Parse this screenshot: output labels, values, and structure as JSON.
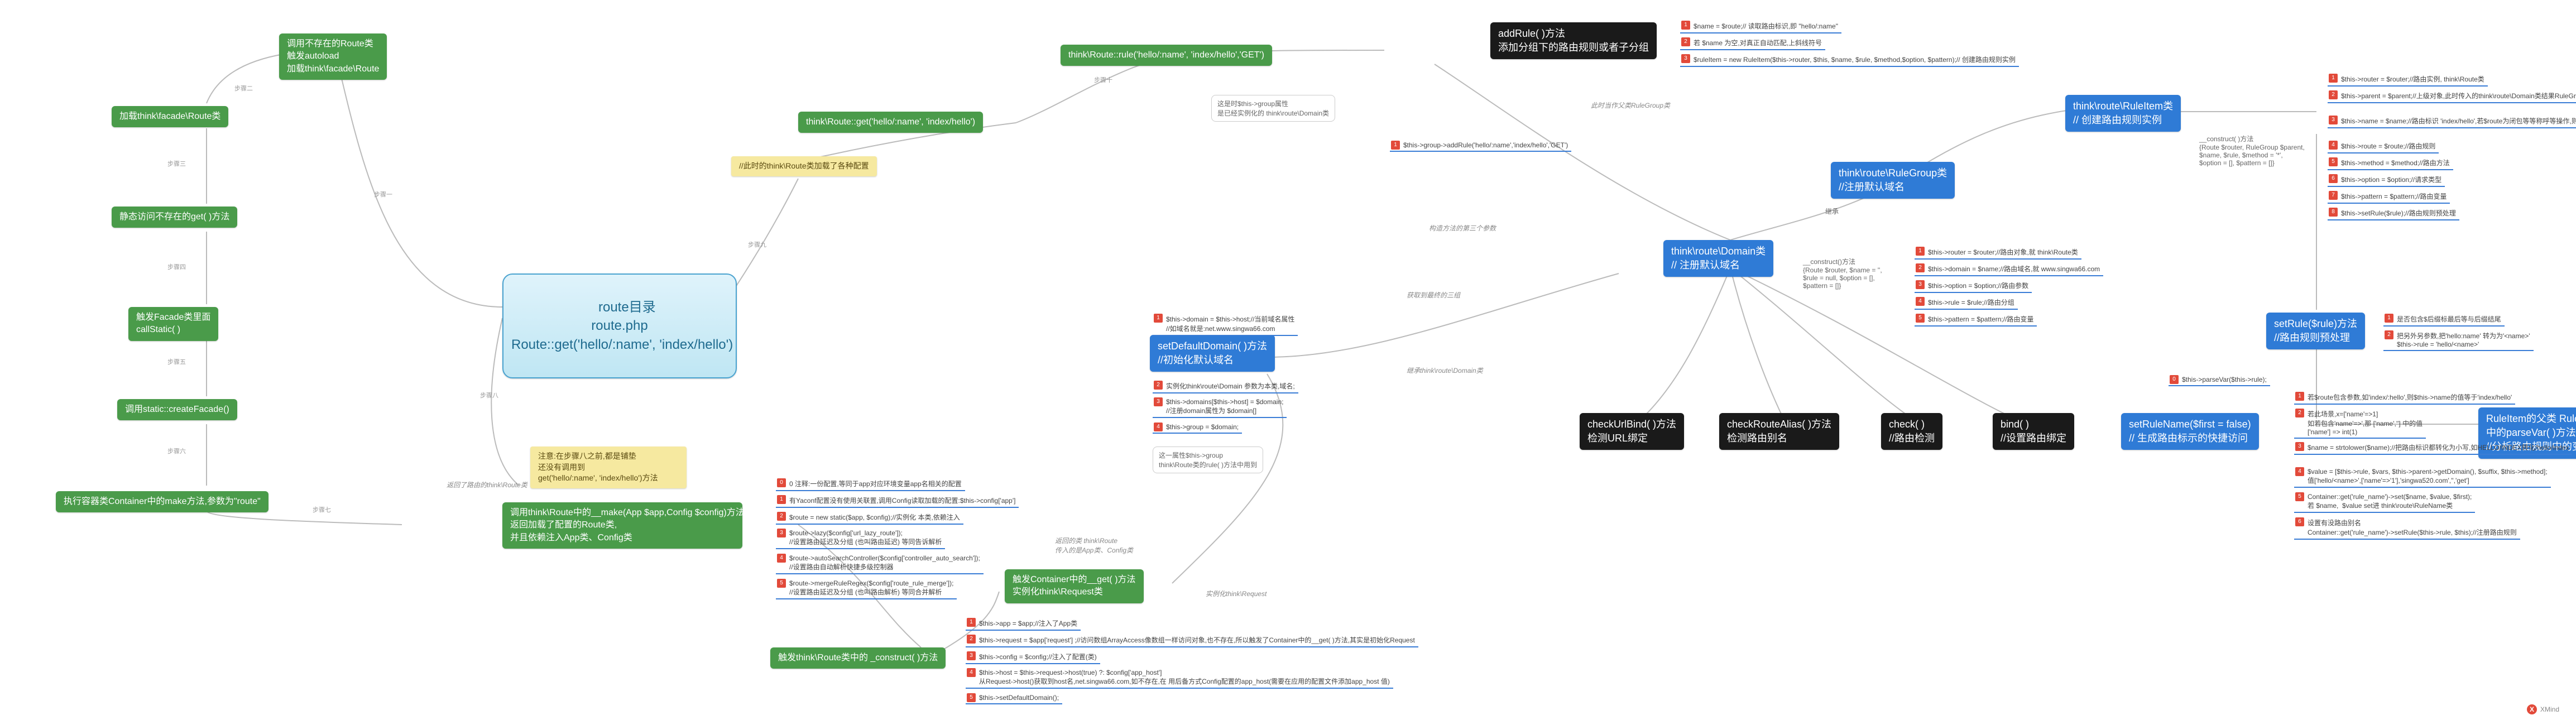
{
  "central": "route目录\nroute.php\nRoute::get('hello/:name', 'index/hello')",
  "left": {
    "n1": "调用不存在的Route类\n触发autoload\n加载think\\facade\\Route",
    "n2": "加载think\\facade\\Route类",
    "n3": "静态访问不存在的get( )方法",
    "n4": "触发Facade类里面\ncallStatic( )",
    "n5": "调用static::createFacade()",
    "n6": "执行容器类Container中的make方法,参数为\"route\"",
    "y1": "注意:在步骤八之前,都是铺垫\n还没有调用到\nget('hello/:name', 'index/hello')方法",
    "g1": "调用think\\Route中的__make(App $app,Config $config)方法,\n返回加载了配置的Route类,\n并且依赖注入App类、Config类"
  },
  "top": {
    "y2": "//此时的think\\Route类加载了各种配置",
    "g2": "think\\Route::get('hello/:name', 'index/hello')",
    "g3": "think\\Route::rule('hello/:name', 'index/hello','GET')",
    "callout1": "这是时$this->group属性\n是已经实例化的 think\\route\\Domain类",
    "t1": "$this->group->addRule('hello/:name','index/hello','GET')"
  },
  "black": {
    "addRule": "addRule( )方法\n添加分组下的路由规则或者子分组",
    "checkUrlBind": "checkUrlBind( )方法\n检测URL绑定",
    "checkRouteAlias": "checkRouteAlias( )方法\n检测路由别名",
    "check": "check( )\n//路由检测",
    "bind": "bind( )\n//设置路由绑定"
  },
  "blue": {
    "setDefaultDomain": "setDefaultDomain( )方法\n//初始化默认域名",
    "ruleGroup": "think\\route\\RuleGroup类\n//注册默认域名",
    "domain": "think\\route\\Domain类\n// 注册默认域名",
    "ruleItem": "think\\route\\RuleItem类\n// 创建路由规则实例",
    "setRule": "setRule($rule)方法\n//路由规则预处理",
    "setRuleName": "setRuleName($first = false)\n// 生成路由标示的快捷访问",
    "parseVar": "RuleItem的父类 Rule类\n中的parseVar( )方法\n//分析路由规则中的变量"
  },
  "green_bottom": {
    "containerGet": "触发Container中的__get( )方法\n实例化think\\Request类",
    "construct": "触发think\\Route类中的 _construct( )方法"
  },
  "notes_make": [
    "0 注释:一份配置,等同于app对应环境变量app名相关的配置",
    "有Yaconf配置没有使用关联置,调用Config读取加载的配置:$this->config['app']",
    "$route = new static($app, $config);//实例化 本类,依赖注入",
    "$route->lazy($config['url_lazy_route']);\n//设置路由延迟及分组 (也叫路由延迟) 等同告诉解析",
    "$route->autoSearchController($config['controller_auto_search']);\n//设置路由自动解析快捷多级控制器",
    "$route->mergeRuleRegex($config['route_rule_merge']);\n//设置路由延迟及分组 (也叫路由解析) 等同合并解析"
  ],
  "notes_construct": [
    "$this->app = $app;//注入了App类",
    "$this->request = $app['request'] ;//访问数组ArrayAccess像数组一样访问对象,也不存在,所以触发了Container中的__get( )方法,其实是初始化Request",
    "$this->config = $config;//注入了配置(类)",
    "$this->host = $this->request->host(true) ?: $config['app_host']\n从Request->host()获取到host名,net.singwa66.com,如不存在,在 用后备方式Config配置的app_host(​需要在应用的配置文件添加app_host 值)",
    "$this->setDefaultDomain();"
  ],
  "notes_setDefaultDomain": [
    "$this->domain = $this->host;//当前域名属性\n//如域名就是:net.www.singwa66.com",
    "实例化think\\route\\Domain 参数为本类,域名;",
    "$this->domains[$this->host] = $domain;\n//注册domain属性为 $domain[]",
    "$this->group = $domain;"
  ],
  "callout2": "这一属性$this->group\nthink\\Route类的rule( )方法中用到",
  "labels": {
    "domain_construct": "__construct()方法\n{Route $router, $name = '',\n$rule = null, $option = [],\n$pattern = []}",
    "ruleGroup_label": "继承",
    "ruleItem_construct": "__construct( )方法\n{Route $router, RuleGroup $parent,\n$name, $rule, $method = '*',\n$option = [], $pattern = []}"
  },
  "notes_domain": [
    "$this->router = $router;//路由对象,就 think\\Route类",
    "$this->domain = $name;//路由域名,就 www.singwa66.com",
    "$this->option = $option;//路由参数",
    "$this->rule = $rule;//路由分组",
    "$this->pattern = $pattern;//路由变量"
  ],
  "notes_addRule": [
    "$name = $route;// 读取路由标识,即 \"hello/:name\"",
    "若 $name 为空,对真正自动匹配,上斜线符号",
    "$ruleItem = new RuleItem($this->router, $this, $name, $rule, $method,$option, $pattern);// 创建路由规则实例"
  ],
  "notes_ruleItem": [
    "$this->router = $router;//路由实例, think\\Route类",
    "$this->parent = $parent;//上级对象,此时传入的think\\route\\Domain类结果RuleGroup类",
    "$this->name = $name;//路由标识 'index/hello',若$route为闭包等等称呼等操作,则name=null",
    "$this->route = $route;//路由规则",
    "$this->method = $method;//路由方法",
    "$this->option = $option;//请求类型",
    "$this->pattern = $pattern;//路由变量",
    "$this->setRule($rule);//路由规则预处理"
  ],
  "notes_setRule": [
    "是否包含$后缀标最后等与后缀结尾",
    "把另外另参数,把'hello:name' 转为为'<name>'\n$this->rule = 'hello/<name>'",
    "$this->parseVar($this->rule);",
    "若$route包含参数,如'index/:hello',则$this->name的值等于'index/hello'",
    "若此场景,x=['name'=>1]\n如若包含'name'=>',那 ['name',''] 中的值\n['name'] => int(1)",
    "$name = strtolower($name);//把路由标识都转化为小写,如HELLO/INDEX转化/hello/index",
    "$value = [$this->rule, $vars, $this->parent->getDomain(), $suffix, $this->method];\n值['hello/<name>',['name'=>'1'],'singwa520.com','','get']",
    "Container::get('rule_name')->set($name, $value, $first);\n若 $name,  $value set进 think\\route\\RuleName类",
    "设置有没路由别名\nContainer::get('rule_name')->setRule($this->rule, $this);//注册路由规则"
  ],
  "tips": {
    "t_return_route": "返回了路由的think\\Route类",
    "t_return_config": "返回的类 think\\Route\n传入的是App类、Config类",
    "t_extend": "继承think\\route\\Domain类",
    "t_instance": "实例化think\\Request",
    "t_cons_inv": "构造方法的第三个参数",
    "t_step_ret": "获取到最终的三组",
    "t_invoke": "此时当作父类RuleGroup类"
  },
  "steps": {
    "s1": "步骤一",
    "s2": "步骤二",
    "s3": "步骤三",
    "s4": "步骤四",
    "s5": "步骤五",
    "s6": "步骤六",
    "s7": "步骤七",
    "s8": "步骤八",
    "s9": "步骤九",
    "s10": "步骤十"
  },
  "footer": "XMind"
}
